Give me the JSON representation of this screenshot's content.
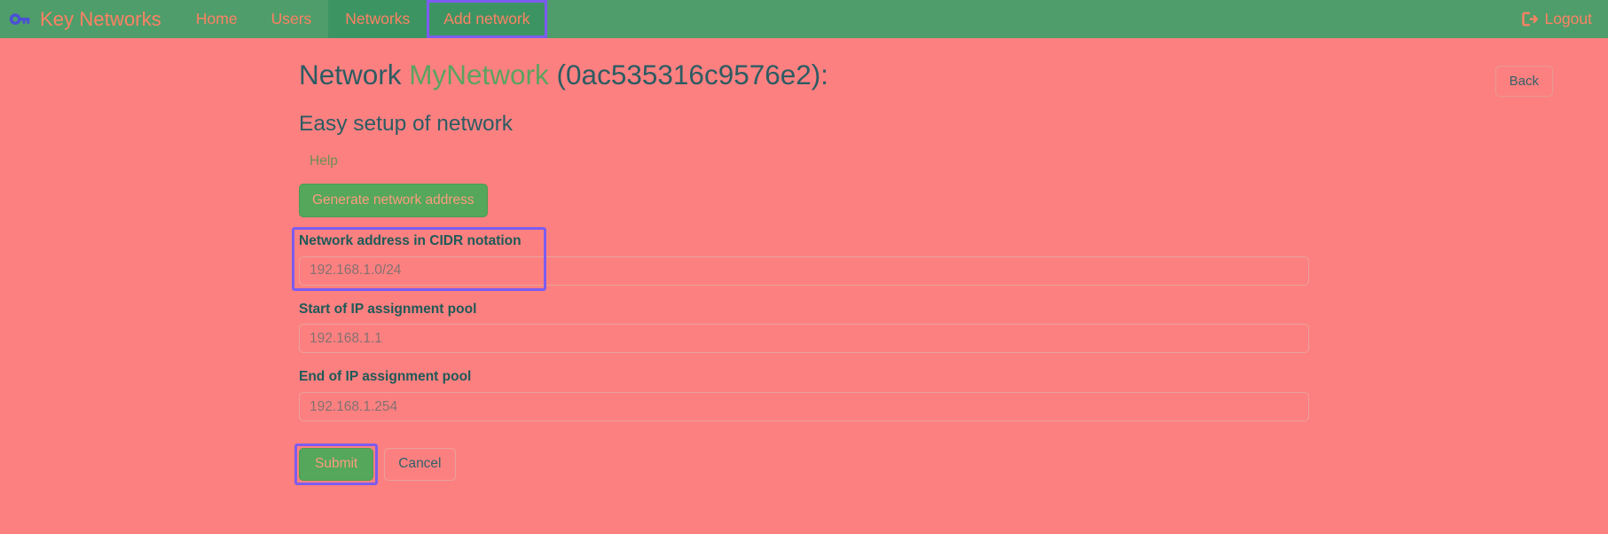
{
  "navbar": {
    "brand": "Key Networks",
    "brand_icon": "key-icon",
    "brand_icon_color": "#4b4fd6",
    "background_color": "#4f9d6b",
    "link_color": "#fd8163",
    "links": [
      {
        "label": "Home",
        "state": "normal"
      },
      {
        "label": "Users",
        "state": "normal"
      },
      {
        "label": "Networks",
        "state": "active"
      },
      {
        "label": "Add network",
        "state": "focused"
      }
    ],
    "logout": {
      "label": "Logout",
      "icon": "sign-out-icon"
    }
  },
  "page": {
    "title_prefix": "Network ",
    "network_name": "MyNetwork",
    "title_suffix": " (0ac535316c9576e2):",
    "network_id": "0ac535316c9576e2",
    "network_name_color": "#5ba35f",
    "title_color": "#2c5c63",
    "subtitle": "Easy setup of network",
    "back_label": "Back",
    "help_label": "Help",
    "background_color": "#fd8080"
  },
  "form": {
    "generate_label": "Generate network address",
    "fields": [
      {
        "label": "Network address in CIDR notation",
        "placeholder": "192.168.1.0/24",
        "value": "",
        "highlighted": true
      },
      {
        "label": "Start of IP assignment pool",
        "placeholder": "192.168.1.1",
        "value": "",
        "highlighted": false
      },
      {
        "label": "End of IP assignment pool",
        "placeholder": "192.168.1.254",
        "value": "",
        "highlighted": false
      }
    ],
    "submit_label": "Submit",
    "cancel_label": "Cancel",
    "submit_highlighted": true,
    "highlight_color": "#7c5cf0",
    "button_color": "#54a75b"
  }
}
